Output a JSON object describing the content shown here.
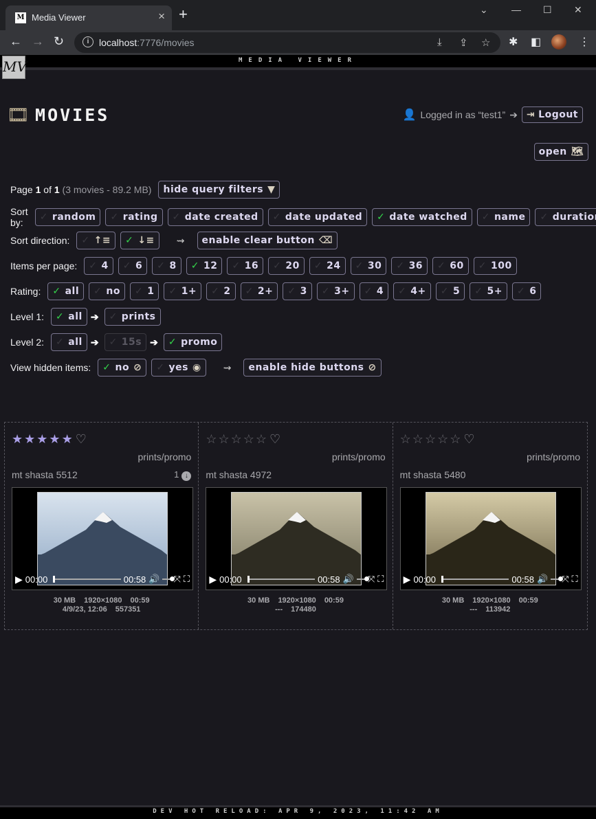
{
  "browser": {
    "tab_title": "Media Viewer",
    "url_host": "localhost",
    "url_path": ":7776/movies"
  },
  "app": {
    "banner": "MEDIA VIEWER",
    "logo_text": "MV",
    "page_title": "MOVIES",
    "logged_in_text": "Logged in as “test1”",
    "logout_label": "Logout",
    "open_label": "open",
    "footer": "DEV HOT RELOAD: APR 9, 2023, 11:42 AM"
  },
  "filters": {
    "page_word": "Page",
    "page_current": "1",
    "page_of": "of",
    "page_total": "1",
    "page_summary": "(3 movies - 89.2 MB)",
    "hide_filters_label": "hide query filters",
    "sort_by_label": "Sort by:",
    "sort_by": [
      {
        "label": "random",
        "on": false
      },
      {
        "label": "rating",
        "on": false
      },
      {
        "label": "date created",
        "on": false
      },
      {
        "label": "date updated",
        "on": false
      },
      {
        "label": "date watched",
        "on": true
      },
      {
        "label": "name",
        "on": false
      },
      {
        "label": "duration",
        "on": false
      }
    ],
    "sort_dir_label": "Sort direction:",
    "sort_dir": [
      {
        "icon": "sort-ascending-icon",
        "on": false
      },
      {
        "icon": "sort-descending-icon",
        "on": true
      }
    ],
    "clear_button_label": "enable clear button",
    "items_label": "Items per page:",
    "items": [
      {
        "label": "4",
        "on": false
      },
      {
        "label": "6",
        "on": false
      },
      {
        "label": "8",
        "on": false
      },
      {
        "label": "12",
        "on": true
      },
      {
        "label": "16",
        "on": false
      },
      {
        "label": "20",
        "on": false
      },
      {
        "label": "24",
        "on": false
      },
      {
        "label": "30",
        "on": false
      },
      {
        "label": "36",
        "on": false
      },
      {
        "label": "60",
        "on": false
      },
      {
        "label": "100",
        "on": false
      }
    ],
    "rating_label": "Rating:",
    "ratings": [
      {
        "label": "all",
        "on": true
      },
      {
        "label": "no",
        "on": false
      },
      {
        "label": "1",
        "on": false
      },
      {
        "label": "1+",
        "on": false
      },
      {
        "label": "2",
        "on": false
      },
      {
        "label": "2+",
        "on": false
      },
      {
        "label": "3",
        "on": false
      },
      {
        "label": "3+",
        "on": false
      },
      {
        "label": "4",
        "on": false
      },
      {
        "label": "4+",
        "on": false
      },
      {
        "label": "5",
        "on": false
      },
      {
        "label": "5+",
        "on": false
      },
      {
        "label": "6",
        "on": false
      }
    ],
    "level1_label": "Level 1:",
    "level1": [
      {
        "label": "all",
        "on": true
      },
      {
        "label": "prints",
        "on": false
      }
    ],
    "level2_label": "Level 2:",
    "level2": [
      {
        "label": "all",
        "on": false
      },
      {
        "label": "15s",
        "on": false,
        "disabled": true
      },
      {
        "label": "promo",
        "on": true
      }
    ],
    "hidden_label": "View hidden items:",
    "hidden": [
      {
        "label": "no",
        "on": true
      },
      {
        "label": "yes",
        "on": false
      }
    ],
    "hide_buttons_label": "enable hide buttons"
  },
  "movies": [
    {
      "name": "mt shasta 5512",
      "category": "prints/promo",
      "stars": 5,
      "views": "1",
      "time_current": "00:00",
      "time_total": "00:58",
      "size": "30 MB",
      "resolution": "1920×1080",
      "duration": "00:59",
      "watched": "4/9/23, 12:06",
      "id": "557351",
      "sky": [
        "#d9e3ee",
        "#8fa8c4"
      ],
      "ground": "#3a4a60"
    },
    {
      "name": "mt shasta 4972",
      "category": "prints/promo",
      "stars": 0,
      "views": "",
      "time_current": "00:00",
      "time_total": "00:58",
      "size": "30 MB",
      "resolution": "1920×1080",
      "duration": "00:59",
      "watched": "---",
      "id": "174480",
      "sky": [
        "#c9c2a8",
        "#7a7660"
      ],
      "ground": "#2e2c22"
    },
    {
      "name": "mt shasta 5480",
      "category": "prints/promo",
      "stars": 0,
      "views": "",
      "time_current": "00:00",
      "time_total": "00:58",
      "size": "30 MB",
      "resolution": "1920×1080",
      "duration": "00:59",
      "watched": "---",
      "id": "113942",
      "sky": [
        "#d4caa6",
        "#6e6448"
      ],
      "ground": "#2a2618"
    }
  ]
}
